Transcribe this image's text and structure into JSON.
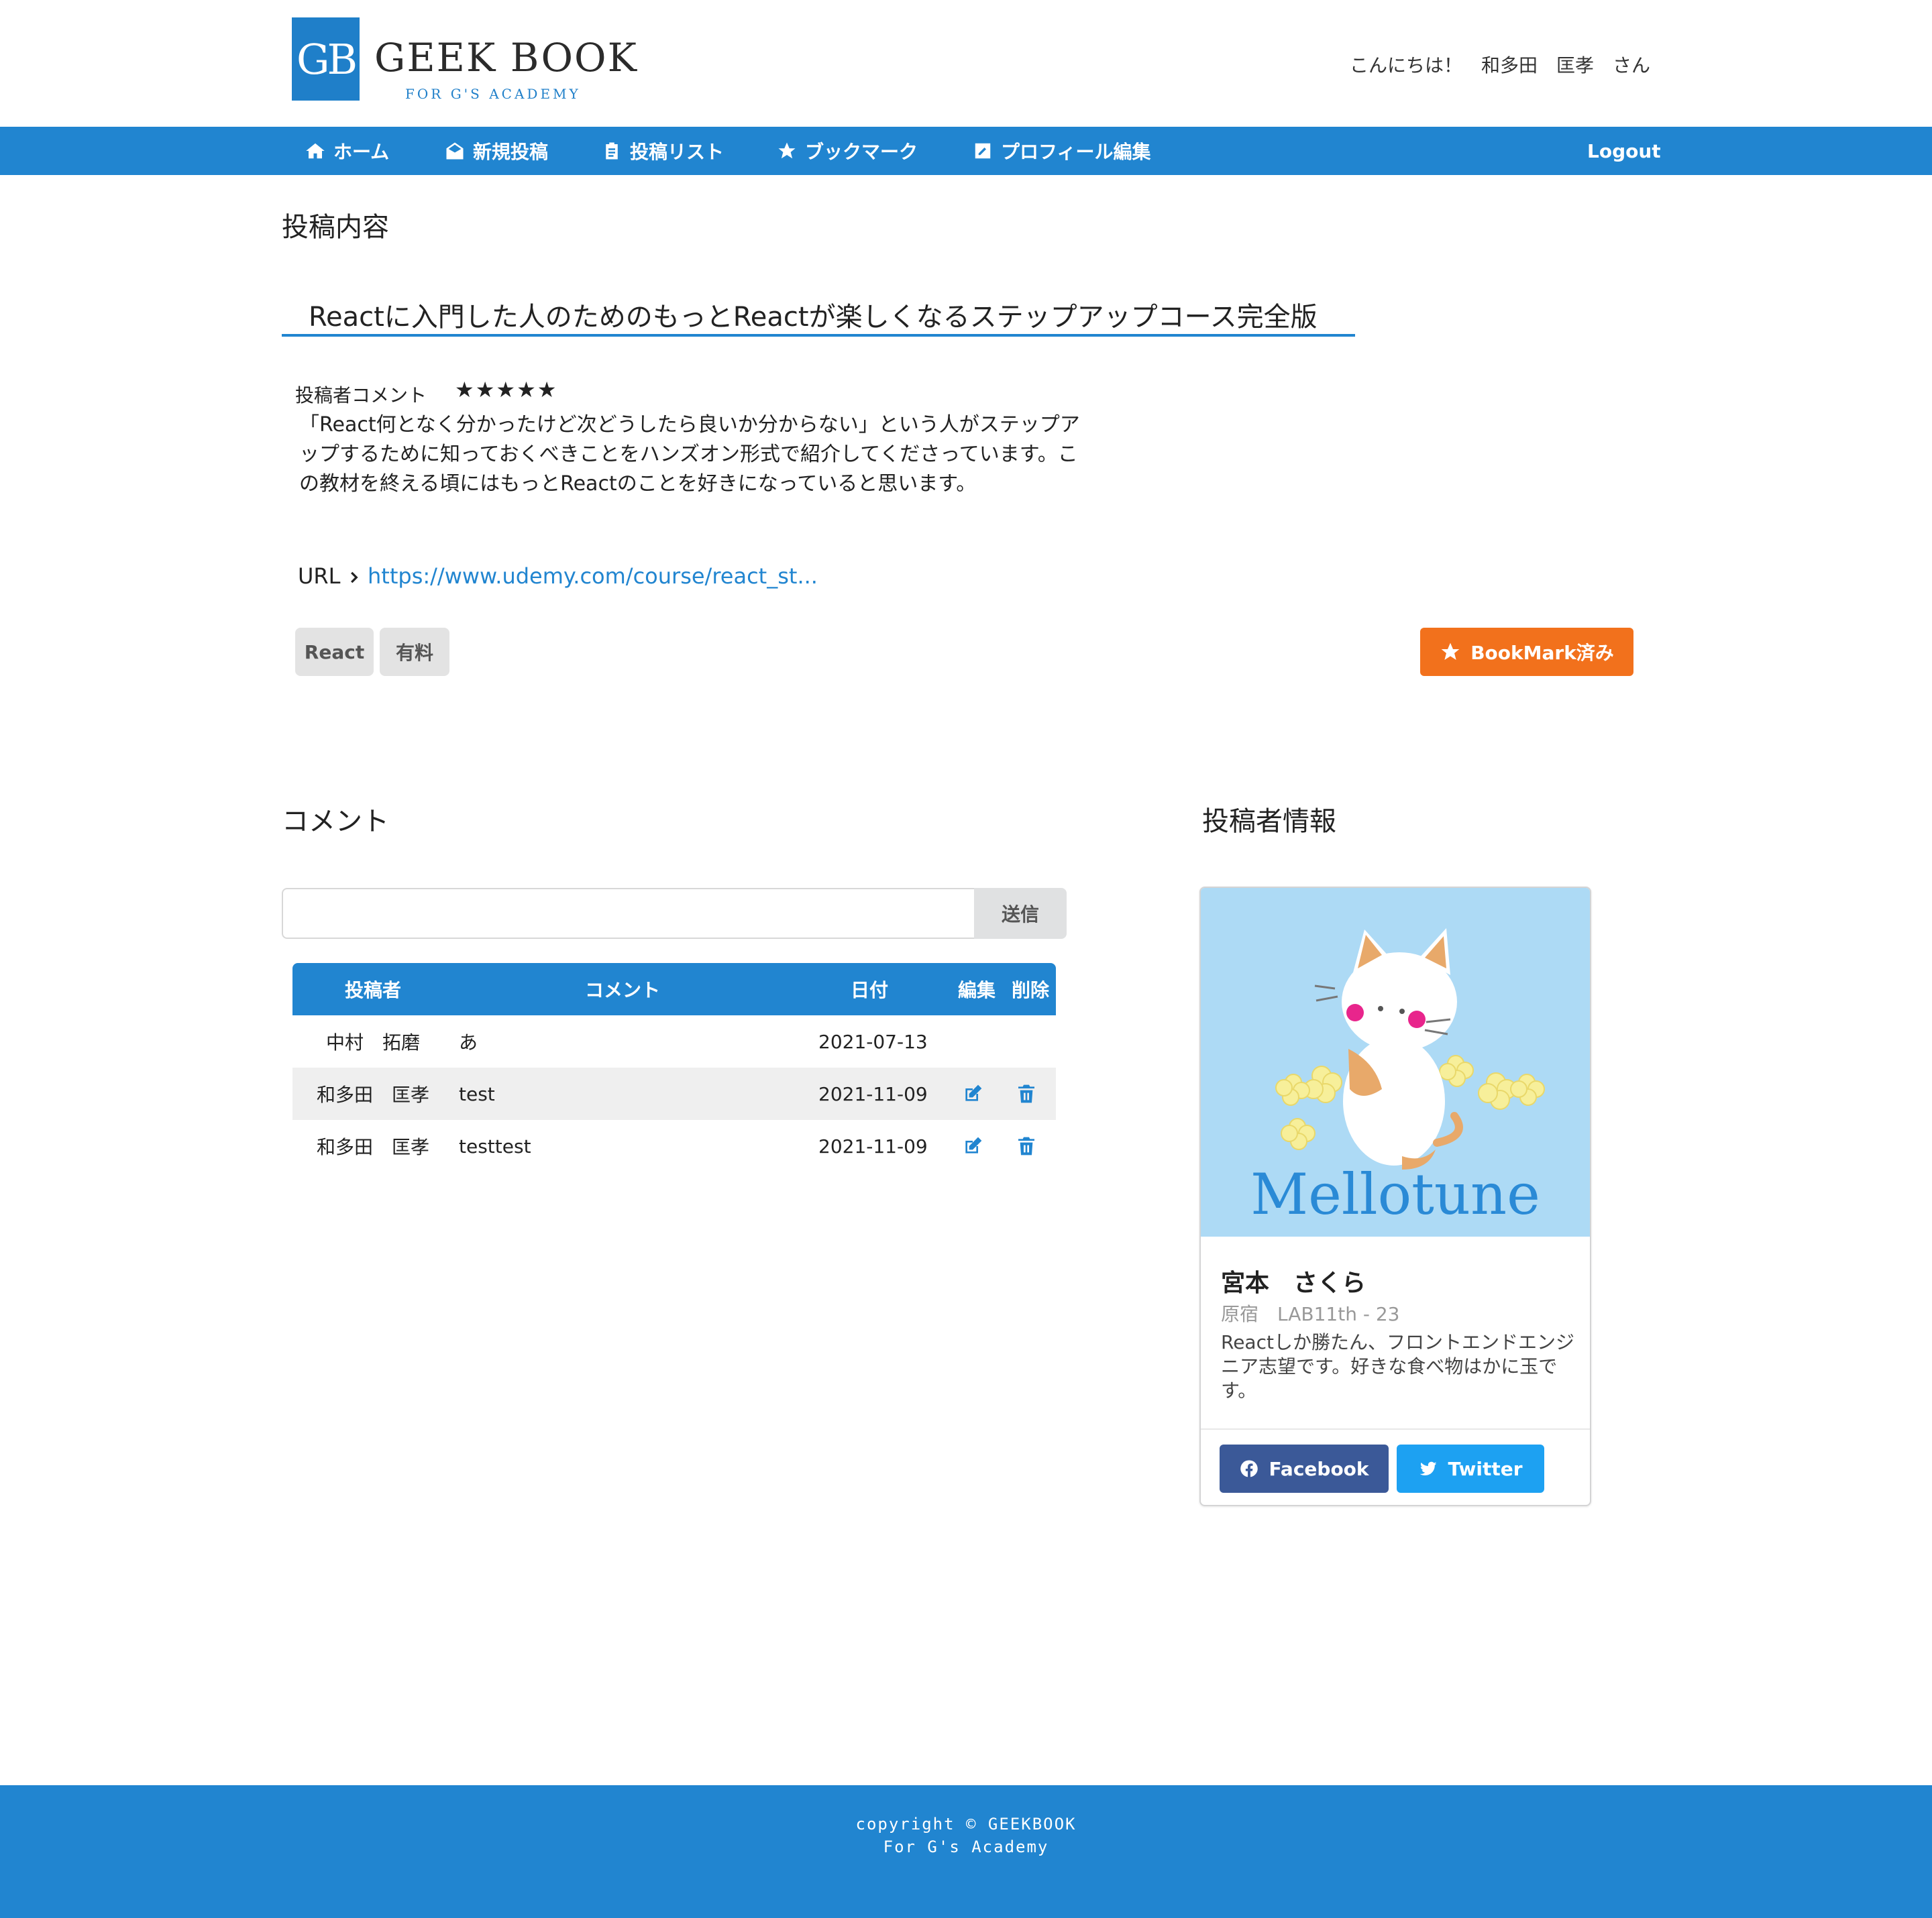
{
  "header": {
    "logo_mark": "GB",
    "logo_name": "GEEK BOOK",
    "logo_sub": "FOR G'S ACADEMY",
    "greeting": "こんにちは！　和多田　匡孝　さん"
  },
  "nav": {
    "items": [
      {
        "label": "ホーム",
        "icon": "home-icon"
      },
      {
        "label": "新規投稿",
        "icon": "envelope-open-icon"
      },
      {
        "label": "投稿リスト",
        "icon": "clipboard-list-icon"
      },
      {
        "label": "ブックマーク",
        "icon": "star-icon"
      },
      {
        "label": "プロフィール編集",
        "icon": "edit-icon"
      }
    ],
    "logout": "Logout"
  },
  "post": {
    "section_title": "投稿内容",
    "title": "Reactに入門した人のためのもっとReactが楽しくなるステップアップコース完全版",
    "comment_label": "投稿者コメント",
    "stars": "★★★★★",
    "rating": 5,
    "body": "「React何となく分かったけど次どうしたら良いか分からない」という人がステップアップするために知っておくべきことをハンズオン形式で紹介してくださっています。この教材を終える頃にはもっとReactのことを好きになっていると思います。",
    "url_label": "URL",
    "url_text": "https://www.udemy.com/course/react_st...",
    "tags": [
      "React",
      "有料"
    ],
    "bookmark_label": "BookMark済み"
  },
  "comments": {
    "section_title": "コメント",
    "input_value": "",
    "send_label": "送信",
    "columns": {
      "author": "投稿者",
      "comment": "コメント",
      "date": "日付",
      "edit": "編集",
      "delete": "削除"
    },
    "rows": [
      {
        "author": "中村　拓磨",
        "comment": "あ",
        "date": "2021-07-13",
        "editable": false
      },
      {
        "author": "和多田　匡孝",
        "comment": "test",
        "date": "2021-11-09",
        "editable": true
      },
      {
        "author": "和多田　匡孝",
        "comment": "testtest",
        "date": "2021-11-09",
        "editable": true
      }
    ]
  },
  "author": {
    "section_title": "投稿者情報",
    "image_text": "Mellotune",
    "name": "宮本　さくら",
    "meta": "原宿　LAB11th - 23",
    "description": "Reactしか勝たん、フロントエンドエンジニア志望です。好きな食べ物はかに玉です。",
    "facebook_label": "Facebook",
    "twitter_label": "Twitter",
    "colors": {
      "facebook": "#3b5998",
      "twitter": "#1da1f2"
    }
  },
  "footer": {
    "line1": "copyright © GEEKBOOK",
    "line2": "For G's Academy"
  },
  "colors": {
    "primary": "#2185d0",
    "bookmark": "#f2711c"
  }
}
